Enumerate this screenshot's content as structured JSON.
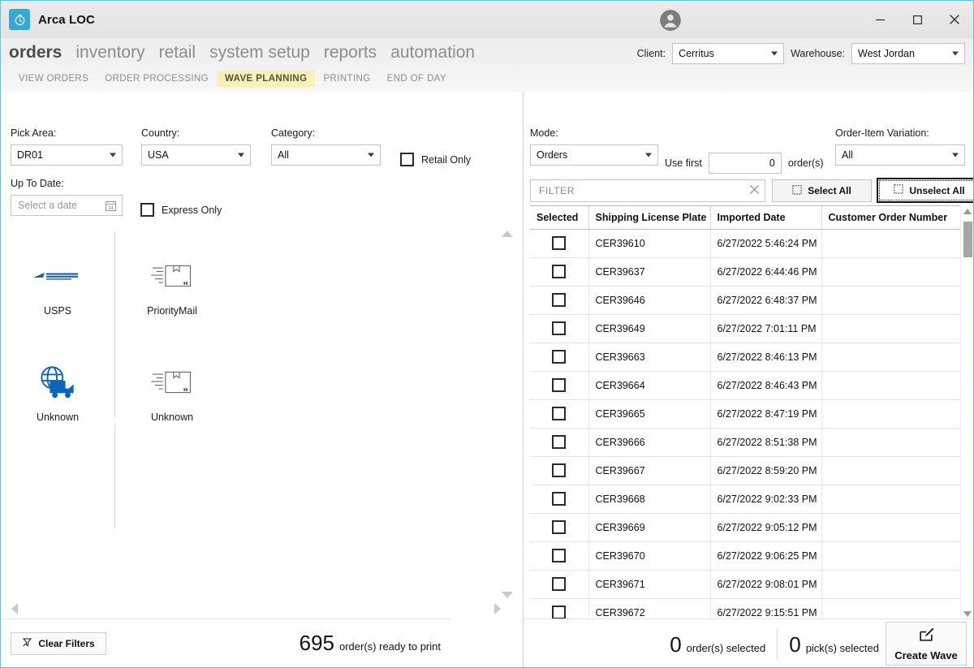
{
  "window": {
    "app_title": "Arca LOC",
    "app_icon": "stopwatch-icon",
    "minimize": "minimize-icon",
    "maximize": "maximize-icon",
    "close": "close-icon",
    "user_icon": "user-account-icon"
  },
  "main_nav": [
    {
      "label": "orders",
      "active": true
    },
    {
      "label": "inventory",
      "active": false
    },
    {
      "label": "retail",
      "active": false
    },
    {
      "label": "system setup",
      "active": false
    },
    {
      "label": "reports",
      "active": false
    },
    {
      "label": "automation",
      "active": false
    }
  ],
  "sub_nav": [
    {
      "label": "VIEW ORDERS",
      "active": false
    },
    {
      "label": "ORDER PROCESSING",
      "active": false
    },
    {
      "label": "WAVE PLANNING",
      "active": true
    },
    {
      "label": "PRINTING",
      "active": false
    },
    {
      "label": "END OF DAY",
      "active": false
    }
  ],
  "selectors": {
    "client_label": "Client:",
    "client_value": "Cerritus",
    "warehouse_label": "Warehouse:",
    "warehouse_value": "West Jordan"
  },
  "filters": {
    "pick_area_label": "Pick Area:",
    "pick_area_value": "DR01",
    "country_label": "Country:",
    "country_value": "USA",
    "category_label": "Category:",
    "category_value": "All",
    "retail_only_label": "Retail Only",
    "retail_only_checked": false,
    "up_to_date_label": "Up To Date:",
    "up_to_date_placeholder": "Select a date",
    "calendar_icon": "calendar-icon",
    "express_only_label": "Express Only",
    "express_only_checked": false
  },
  "carriers": [
    {
      "label": "USPS",
      "icon": "usps-logo-icon",
      "col": 0,
      "row": 0
    },
    {
      "label": "PriorityMail",
      "icon": "package-box-icon",
      "col": 1,
      "row": 0
    },
    {
      "label": "Unknown",
      "icon": "globe-truck-icon",
      "col": 0,
      "row": 1
    },
    {
      "label": "Unknown",
      "icon": "package-box-icon",
      "col": 1,
      "row": 1
    }
  ],
  "orders_panel": {
    "mode_label": "Mode:",
    "mode_value": "Orders",
    "use_first_label": "Use first",
    "use_first_value": "0",
    "orders_suffix_label": "order(s)",
    "variation_label": "Order-Item Variation:",
    "variation_value": "All",
    "filter_placeholder": "FILTER",
    "filter_value": "",
    "clear_filter_icon": "clear-x-icon",
    "select_all_label": "Select All",
    "select_all_icon": "select-all-icon",
    "unselect_all_label": "Unselect All",
    "unselect_all_icon": "unselect-all-icon",
    "columns": [
      "Selected",
      "Shipping License Plate",
      "Imported Date",
      "Customer Order Number"
    ],
    "rows": [
      {
        "selected": false,
        "slp": "CER39610",
        "imported": "6/27/2022 5:46:24 PM",
        "con": ""
      },
      {
        "selected": false,
        "slp": "CER39637",
        "imported": "6/27/2022 6:44:46 PM",
        "con": ""
      },
      {
        "selected": false,
        "slp": "CER39646",
        "imported": "6/27/2022 6:48:37 PM",
        "con": ""
      },
      {
        "selected": false,
        "slp": "CER39649",
        "imported": "6/27/2022 7:01:11 PM",
        "con": ""
      },
      {
        "selected": false,
        "slp": "CER39663",
        "imported": "6/27/2022 8:46:13 PM",
        "con": ""
      },
      {
        "selected": false,
        "slp": "CER39664",
        "imported": "6/27/2022 8:46:43 PM",
        "con": ""
      },
      {
        "selected": false,
        "slp": "CER39665",
        "imported": "6/27/2022 8:47:19 PM",
        "con": ""
      },
      {
        "selected": false,
        "slp": "CER39666",
        "imported": "6/27/2022 8:51:38 PM",
        "con": ""
      },
      {
        "selected": false,
        "slp": "CER39667",
        "imported": "6/27/2022 8:59:20 PM",
        "con": ""
      },
      {
        "selected": false,
        "slp": "CER39668",
        "imported": "6/27/2022 9:02:33 PM",
        "con": ""
      },
      {
        "selected": false,
        "slp": "CER39669",
        "imported": "6/27/2022 9:05:12 PM",
        "con": ""
      },
      {
        "selected": false,
        "slp": "CER39670",
        "imported": "6/27/2022 9:06:25 PM",
        "con": ""
      },
      {
        "selected": false,
        "slp": "CER39671",
        "imported": "6/27/2022 9:08:01 PM",
        "con": ""
      },
      {
        "selected": false,
        "slp": "CER39672",
        "imported": "6/27/2022 9:15:51 PM",
        "con": ""
      }
    ]
  },
  "footer": {
    "clear_filters_label": "Clear Filters",
    "clear_filters_icon": "funnel-clear-icon",
    "ready_count": "695",
    "ready_label": "order(s) ready to print",
    "orders_selected_count": "0",
    "orders_selected_label": "order(s) selected",
    "picks_selected_count": "0",
    "picks_selected_label": "pick(s) selected",
    "create_wave_label": "Create Wave",
    "create_wave_icon": "edit-square-icon"
  },
  "colors": {
    "accent": "#34a8d8",
    "window_border": "#5fc3e4",
    "active_tab_bg": "#f7f0b8",
    "usps_blue": "#1a5fa8",
    "carrier_blue": "#0b66b8"
  }
}
